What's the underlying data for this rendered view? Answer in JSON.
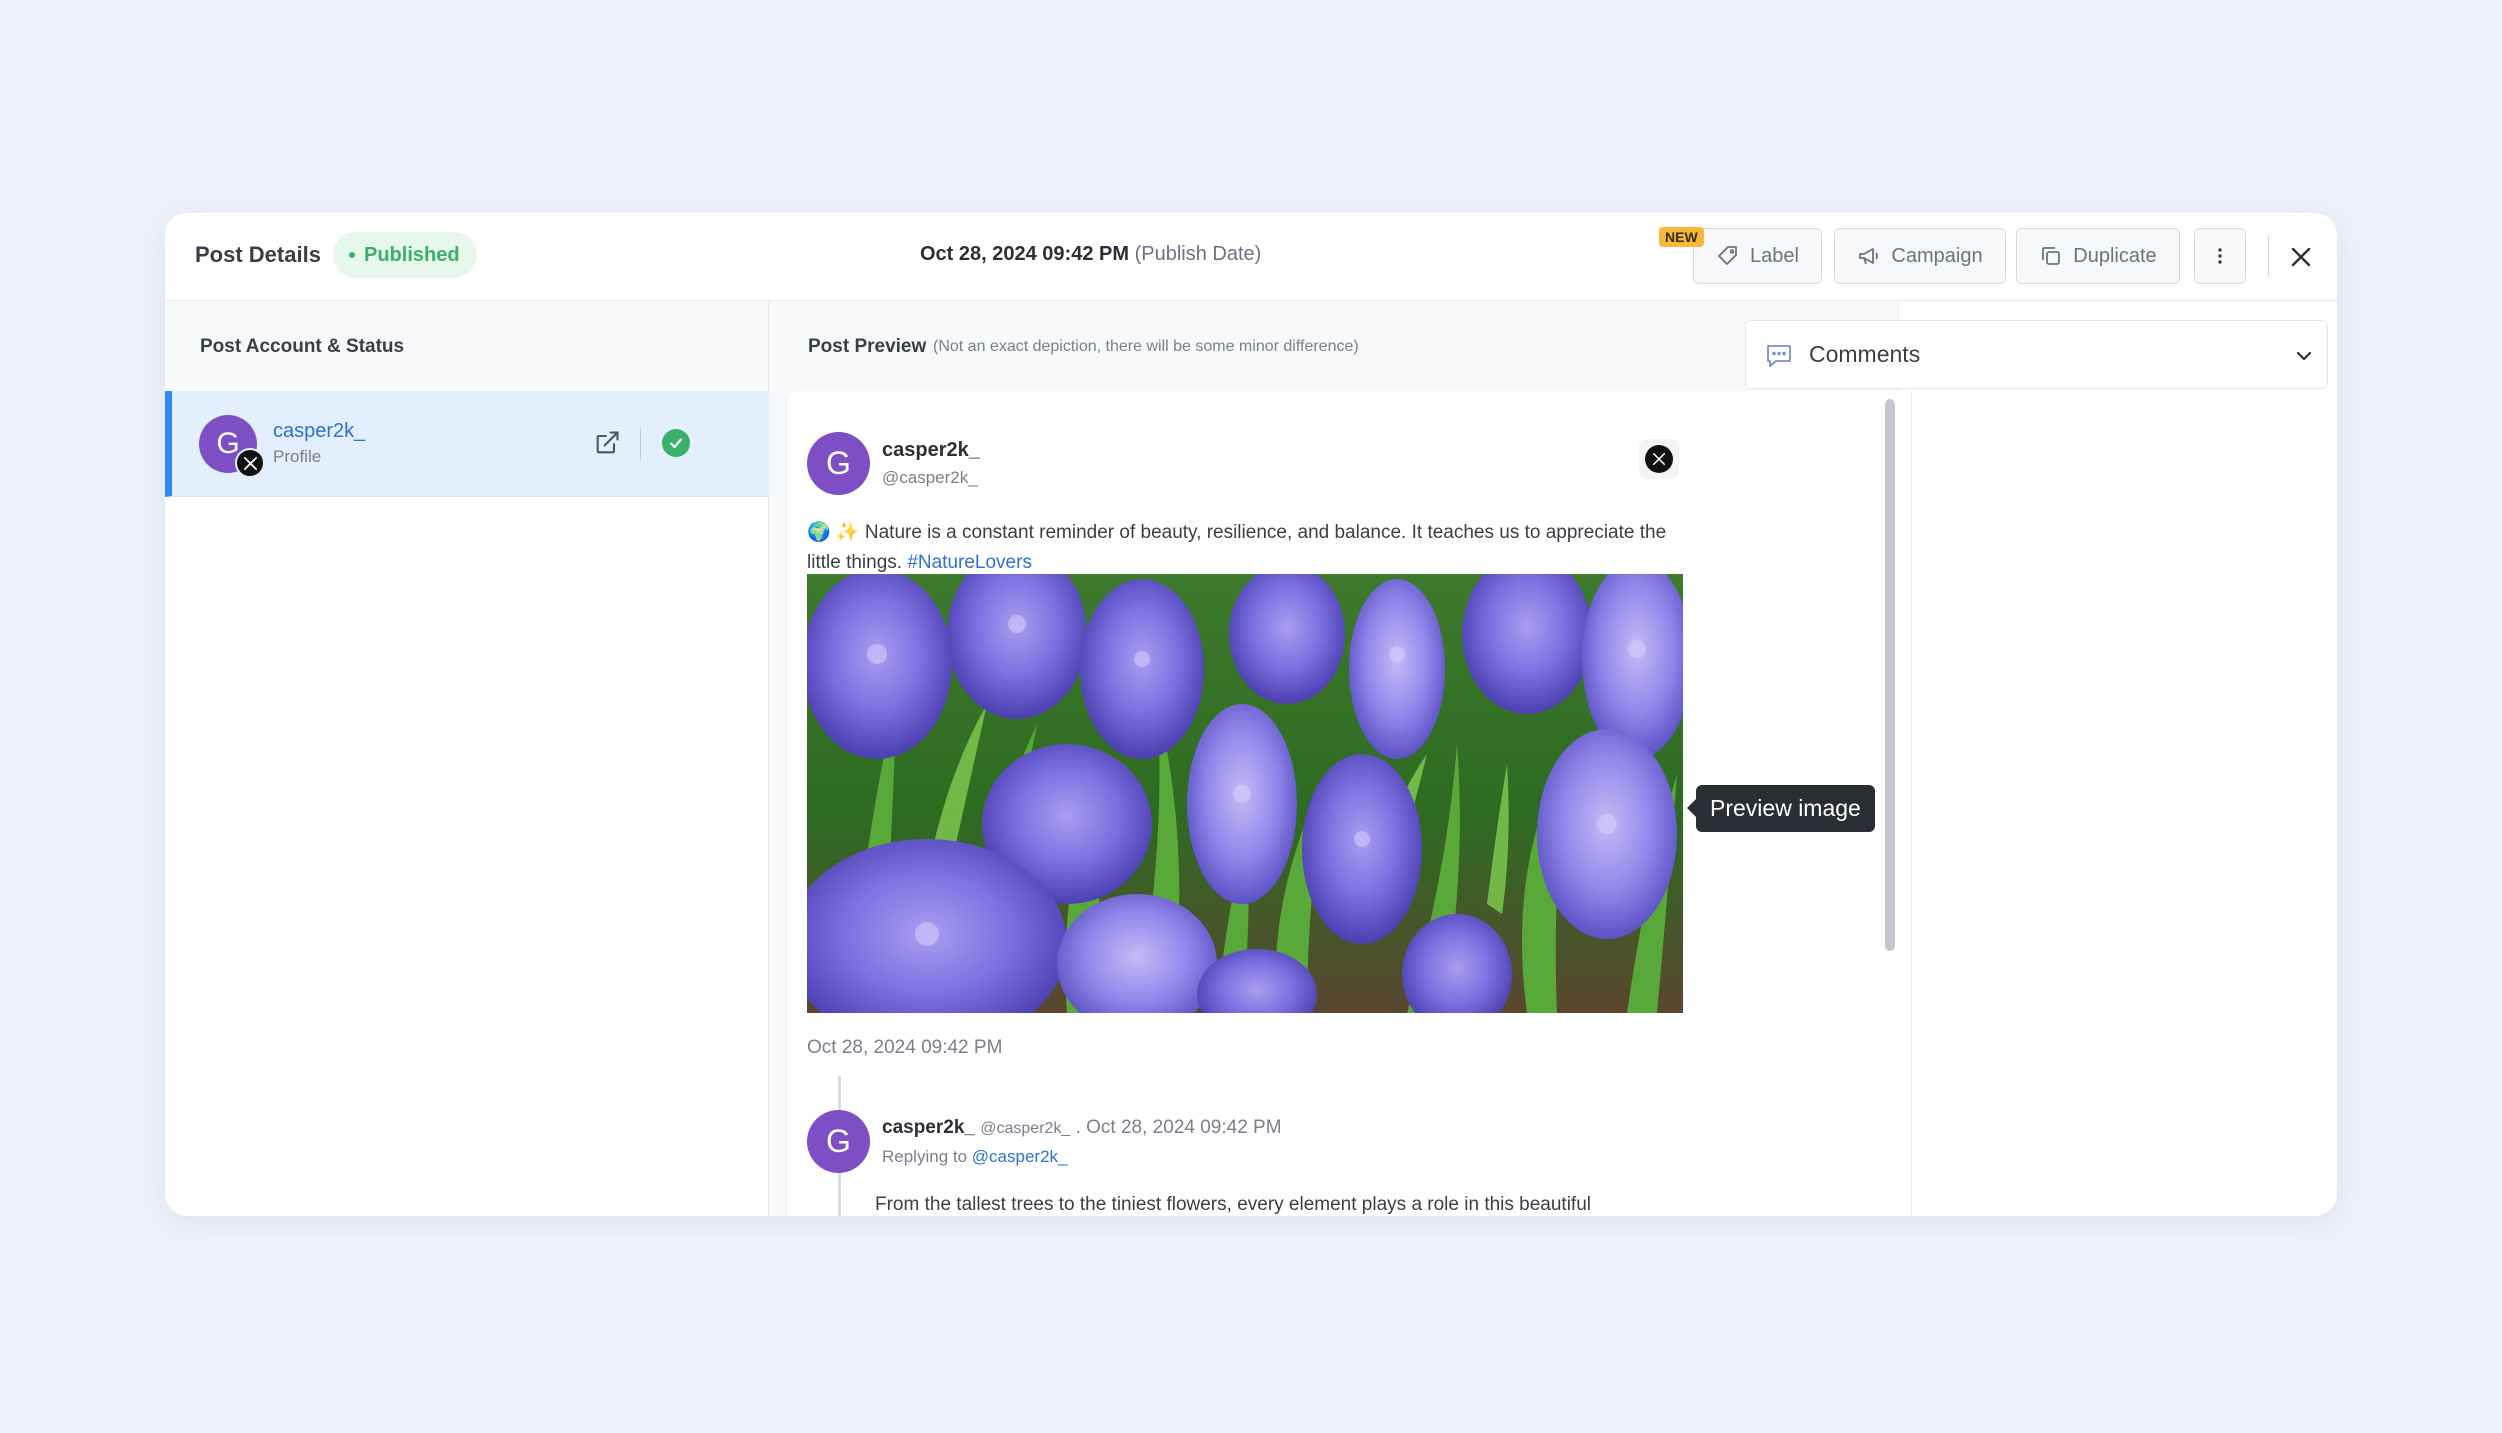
{
  "header": {
    "title": "Post Details",
    "status": "Published",
    "publish_date": "Oct 28, 2024 09:42 PM",
    "publish_date_suffix": "(Publish Date)",
    "new_badge": "NEW",
    "label_btn": "Label",
    "campaign_btn": "Campaign",
    "duplicate_btn": "Duplicate"
  },
  "left": {
    "heading": "Post Account & Status",
    "account": {
      "initial": "G",
      "name": "casper2k_",
      "type": "Profile",
      "platform_icon": "x-logo-icon"
    }
  },
  "preview": {
    "heading": "Post Preview",
    "note": "(Not an exact depiction, there will be some minor difference)",
    "post": {
      "initial": "G",
      "name": "casper2k_",
      "handle": "@casper2k_",
      "text": "🌍 ✨ Nature is a constant reminder of beauty, resilience, and balance. It teaches us to appreciate the little things.",
      "hashtag": "#NatureLovers",
      "date": "Oct 28, 2024 09:42 PM"
    },
    "reply": {
      "initial": "G",
      "name": "casper2k_",
      "handle": "@casper2k_",
      "separator": ".",
      "date": "Oct 28, 2024 09:42 PM",
      "replying_to": "Replying to",
      "mention": "@casper2k_",
      "text": "From the tallest trees to the tiniest flowers, every element plays a role in this beautiful"
    },
    "tooltip": "Preview image"
  },
  "comments": {
    "label": "Comments"
  },
  "colors": {
    "accent": "#2f8cf4",
    "success": "#3bb06a",
    "avatar": "#7e4fc4",
    "link": "#2f6fd6"
  }
}
